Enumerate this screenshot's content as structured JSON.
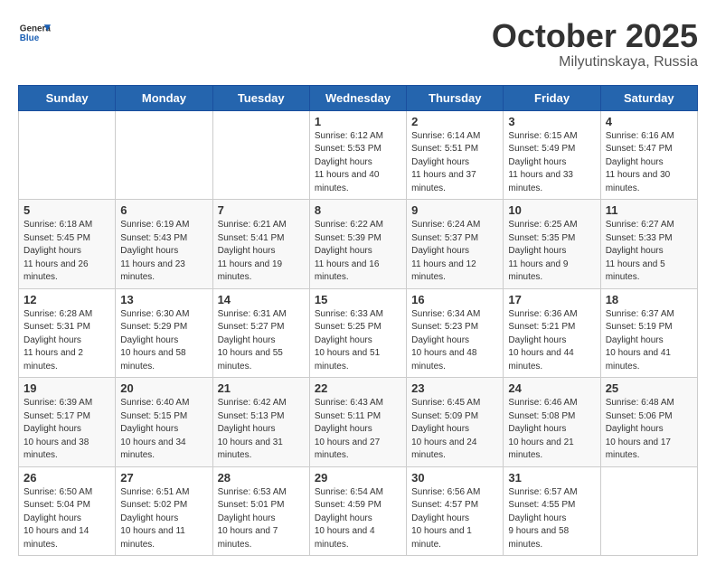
{
  "header": {
    "logo": {
      "general": "General",
      "blue": "Blue"
    },
    "title": "October 2025",
    "location": "Milyutinskaya, Russia"
  },
  "weekdays": [
    "Sunday",
    "Monday",
    "Tuesday",
    "Wednesday",
    "Thursday",
    "Friday",
    "Saturday"
  ],
  "weeks": [
    [
      null,
      null,
      null,
      {
        "day": 1,
        "sunrise": "6:12 AM",
        "sunset": "5:53 PM",
        "daylight": "11 hours and 40 minutes."
      },
      {
        "day": 2,
        "sunrise": "6:14 AM",
        "sunset": "5:51 PM",
        "daylight": "11 hours and 37 minutes."
      },
      {
        "day": 3,
        "sunrise": "6:15 AM",
        "sunset": "5:49 PM",
        "daylight": "11 hours and 33 minutes."
      },
      {
        "day": 4,
        "sunrise": "6:16 AM",
        "sunset": "5:47 PM",
        "daylight": "11 hours and 30 minutes."
      }
    ],
    [
      {
        "day": 5,
        "sunrise": "6:18 AM",
        "sunset": "5:45 PM",
        "daylight": "11 hours and 26 minutes."
      },
      {
        "day": 6,
        "sunrise": "6:19 AM",
        "sunset": "5:43 PM",
        "daylight": "11 hours and 23 minutes."
      },
      {
        "day": 7,
        "sunrise": "6:21 AM",
        "sunset": "5:41 PM",
        "daylight": "11 hours and 19 minutes."
      },
      {
        "day": 8,
        "sunrise": "6:22 AM",
        "sunset": "5:39 PM",
        "daylight": "11 hours and 16 minutes."
      },
      {
        "day": 9,
        "sunrise": "6:24 AM",
        "sunset": "5:37 PM",
        "daylight": "11 hours and 12 minutes."
      },
      {
        "day": 10,
        "sunrise": "6:25 AM",
        "sunset": "5:35 PM",
        "daylight": "11 hours and 9 minutes."
      },
      {
        "day": 11,
        "sunrise": "6:27 AM",
        "sunset": "5:33 PM",
        "daylight": "11 hours and 5 minutes."
      }
    ],
    [
      {
        "day": 12,
        "sunrise": "6:28 AM",
        "sunset": "5:31 PM",
        "daylight": "11 hours and 2 minutes."
      },
      {
        "day": 13,
        "sunrise": "6:30 AM",
        "sunset": "5:29 PM",
        "daylight": "10 hours and 58 minutes."
      },
      {
        "day": 14,
        "sunrise": "6:31 AM",
        "sunset": "5:27 PM",
        "daylight": "10 hours and 55 minutes."
      },
      {
        "day": 15,
        "sunrise": "6:33 AM",
        "sunset": "5:25 PM",
        "daylight": "10 hours and 51 minutes."
      },
      {
        "day": 16,
        "sunrise": "6:34 AM",
        "sunset": "5:23 PM",
        "daylight": "10 hours and 48 minutes."
      },
      {
        "day": 17,
        "sunrise": "6:36 AM",
        "sunset": "5:21 PM",
        "daylight": "10 hours and 44 minutes."
      },
      {
        "day": 18,
        "sunrise": "6:37 AM",
        "sunset": "5:19 PM",
        "daylight": "10 hours and 41 minutes."
      }
    ],
    [
      {
        "day": 19,
        "sunrise": "6:39 AM",
        "sunset": "5:17 PM",
        "daylight": "10 hours and 38 minutes."
      },
      {
        "day": 20,
        "sunrise": "6:40 AM",
        "sunset": "5:15 PM",
        "daylight": "10 hours and 34 minutes."
      },
      {
        "day": 21,
        "sunrise": "6:42 AM",
        "sunset": "5:13 PM",
        "daylight": "10 hours and 31 minutes."
      },
      {
        "day": 22,
        "sunrise": "6:43 AM",
        "sunset": "5:11 PM",
        "daylight": "10 hours and 27 minutes."
      },
      {
        "day": 23,
        "sunrise": "6:45 AM",
        "sunset": "5:09 PM",
        "daylight": "10 hours and 24 minutes."
      },
      {
        "day": 24,
        "sunrise": "6:46 AM",
        "sunset": "5:08 PM",
        "daylight": "10 hours and 21 minutes."
      },
      {
        "day": 25,
        "sunrise": "6:48 AM",
        "sunset": "5:06 PM",
        "daylight": "10 hours and 17 minutes."
      }
    ],
    [
      {
        "day": 26,
        "sunrise": "6:50 AM",
        "sunset": "5:04 PM",
        "daylight": "10 hours and 14 minutes."
      },
      {
        "day": 27,
        "sunrise": "6:51 AM",
        "sunset": "5:02 PM",
        "daylight": "10 hours and 11 minutes."
      },
      {
        "day": 28,
        "sunrise": "6:53 AM",
        "sunset": "5:01 PM",
        "daylight": "10 hours and 7 minutes."
      },
      {
        "day": 29,
        "sunrise": "6:54 AM",
        "sunset": "4:59 PM",
        "daylight": "10 hours and 4 minutes."
      },
      {
        "day": 30,
        "sunrise": "6:56 AM",
        "sunset": "4:57 PM",
        "daylight": "10 hours and 1 minute."
      },
      {
        "day": 31,
        "sunrise": "6:57 AM",
        "sunset": "4:55 PM",
        "daylight": "9 hours and 58 minutes."
      },
      null
    ]
  ]
}
